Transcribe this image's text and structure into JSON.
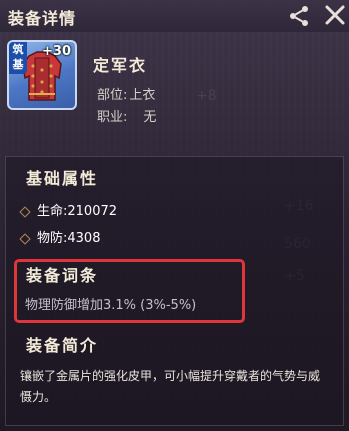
{
  "header": {
    "title": "装备详情"
  },
  "item": {
    "badge": "筑基",
    "level": "+30",
    "name": "定军衣",
    "slot_label": "部位:",
    "slot_value": "上衣",
    "class_label": "职业:",
    "class_value": "无"
  },
  "base_attributes": {
    "title": "基础属性",
    "stats": [
      {
        "label": "生命:",
        "value": "210072"
      },
      {
        "label": "物防:",
        "value": "4308"
      }
    ]
  },
  "affixes": {
    "title": "装备词条",
    "lines": [
      "物理防御增加3.1% (3%-5%)"
    ]
  },
  "description": {
    "title": "装备简介",
    "text": "镶嵌了金属片的强化皮甲，可小幅提升穿戴者的气势与威慑力。"
  },
  "colors": {
    "highlight": "#e0353a",
    "title_text": "#f3ead8",
    "item_frame": "#4c76c4"
  },
  "icons": [
    "share-icon",
    "close-icon",
    "armor-icon",
    "diamond-bullet-icon"
  ]
}
